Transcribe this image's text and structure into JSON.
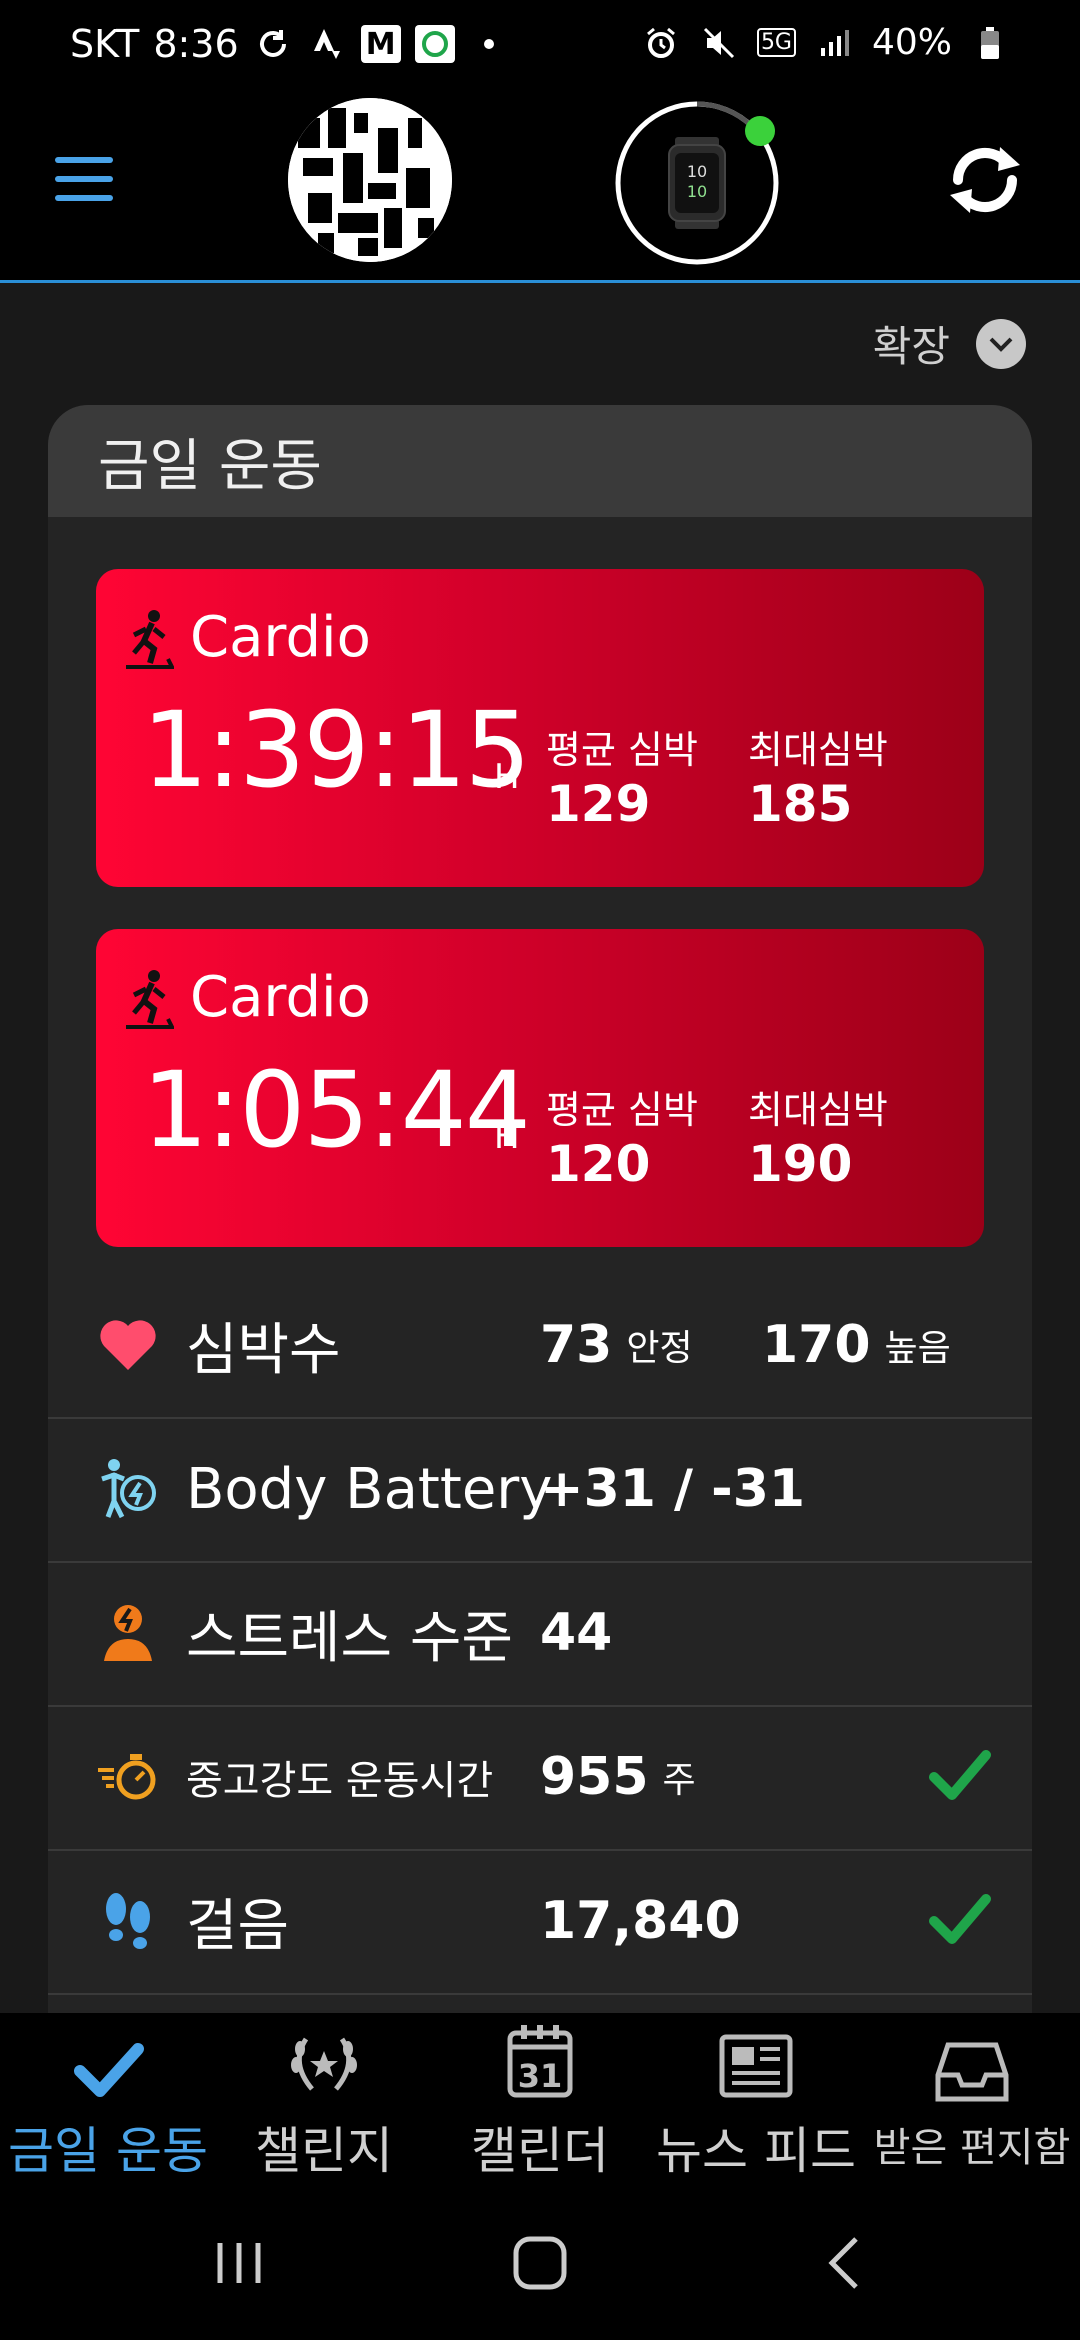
{
  "status_bar": {
    "carrier": "SKT",
    "time": "8:36",
    "network": "5G",
    "battery": "40%"
  },
  "header": {
    "menu_icon": "hamburger-icon",
    "avatar_icon": "qr-avatar",
    "device_icon": "watch-icon",
    "sync_icon": "sync-icon"
  },
  "expand": {
    "label": "확장"
  },
  "today": {
    "title": "금일 운동",
    "activities": [
      {
        "type": "Cardio",
        "duration": "1:39:15",
        "unit": "H",
        "avg_label": "평균 심박",
        "avg": "129",
        "max_label": "최대심박",
        "max": "185"
      },
      {
        "type": "Cardio",
        "duration": "1:05:44",
        "unit": "H",
        "avg_label": "평균 심박",
        "avg": "120",
        "max_label": "최대심박",
        "max": "190"
      }
    ],
    "stats": [
      {
        "name": "심박수",
        "value1": "73",
        "value1_unit": "안정",
        "value2": "170",
        "value2_unit": "높음"
      },
      {
        "name": "Body Battery",
        "value1": "+31 / -31"
      },
      {
        "name": "스트레스 수준",
        "value1": "44"
      },
      {
        "name": "중고강도 운동시간",
        "value1": "955",
        "value1_unit": "주",
        "goal_met": true
      },
      {
        "name": "걸음",
        "value1": "17,840",
        "goal_met": true
      }
    ]
  },
  "bottom_nav": [
    {
      "label": "금일 운동",
      "icon": "check-icon",
      "active": true
    },
    {
      "label": "챌린지",
      "icon": "laurel-icon"
    },
    {
      "label": "캘린더",
      "icon": "calendar-icon",
      "day": "31"
    },
    {
      "label": "뉴스 피드",
      "icon": "newspaper-icon"
    },
    {
      "label": "받은 편지함",
      "icon": "inbox-icon"
    }
  ],
  "colors": {
    "accent": "#4aa3e8",
    "activity_red": "#e8002e",
    "check_green": "#1fa54a",
    "heart": "#ff4d6d",
    "stress_orange": "#f07a1a"
  }
}
